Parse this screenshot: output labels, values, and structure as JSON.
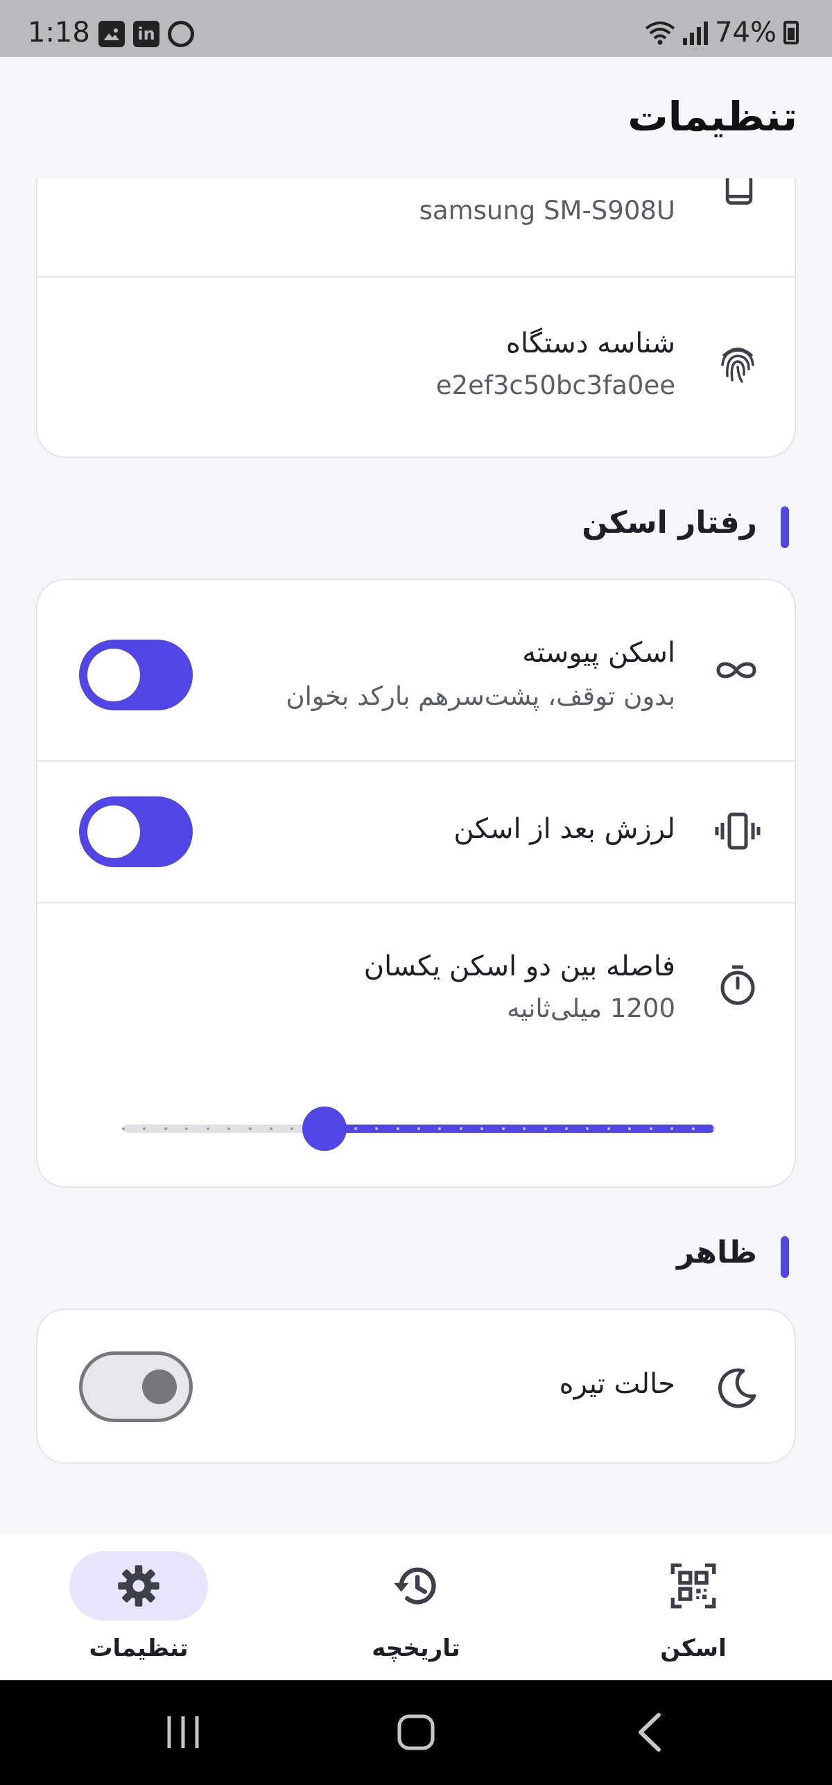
{
  "status_bar": {
    "time": "1:18",
    "battery": "74%",
    "left_icons": [
      "gallery-icon",
      "linkedin-icon",
      "app-icon"
    ],
    "right_icons": [
      "wifi-icon",
      "signal-icon",
      "battery-charging-icon"
    ]
  },
  "header": {
    "title": "تنظیمات"
  },
  "device_card": {
    "model_value": "samsung SM-S908U",
    "device_id_label": "شناسه دستگاه",
    "device_id_value": "e2ef3c50bc3fa0ee"
  },
  "scan_section": {
    "title": "رفتار اسکن",
    "continuous": {
      "label": "اسکن پیوسته",
      "sub": "بدون توقف، پشت‌سرهم بارکد بخوان",
      "enabled": true
    },
    "vibrate": {
      "label": "لرزش بعد از اسکن",
      "enabled": true
    },
    "interval": {
      "label": "فاصله بین دو اسکن یکسان",
      "value_text": "1200 میلی‌ثانیه",
      "value": 1200,
      "slider_fraction": 0.66
    }
  },
  "appearance_section": {
    "title": "ظاهر",
    "dark_mode": {
      "label": "حالت تیره",
      "enabled": false
    }
  },
  "bottom_nav": {
    "items": [
      {
        "label": "تنظیمات",
        "icon": "gear-icon",
        "active": true
      },
      {
        "label": "تاریخچه",
        "icon": "history-icon",
        "active": false
      },
      {
        "label": "اسکن",
        "icon": "qr-scan-icon",
        "active": false
      }
    ]
  },
  "colors": {
    "accent": "#4f46e5",
    "background": "#f5f6fa",
    "card": "#ffffff",
    "nav_active_pill": "#e7e4fb"
  }
}
